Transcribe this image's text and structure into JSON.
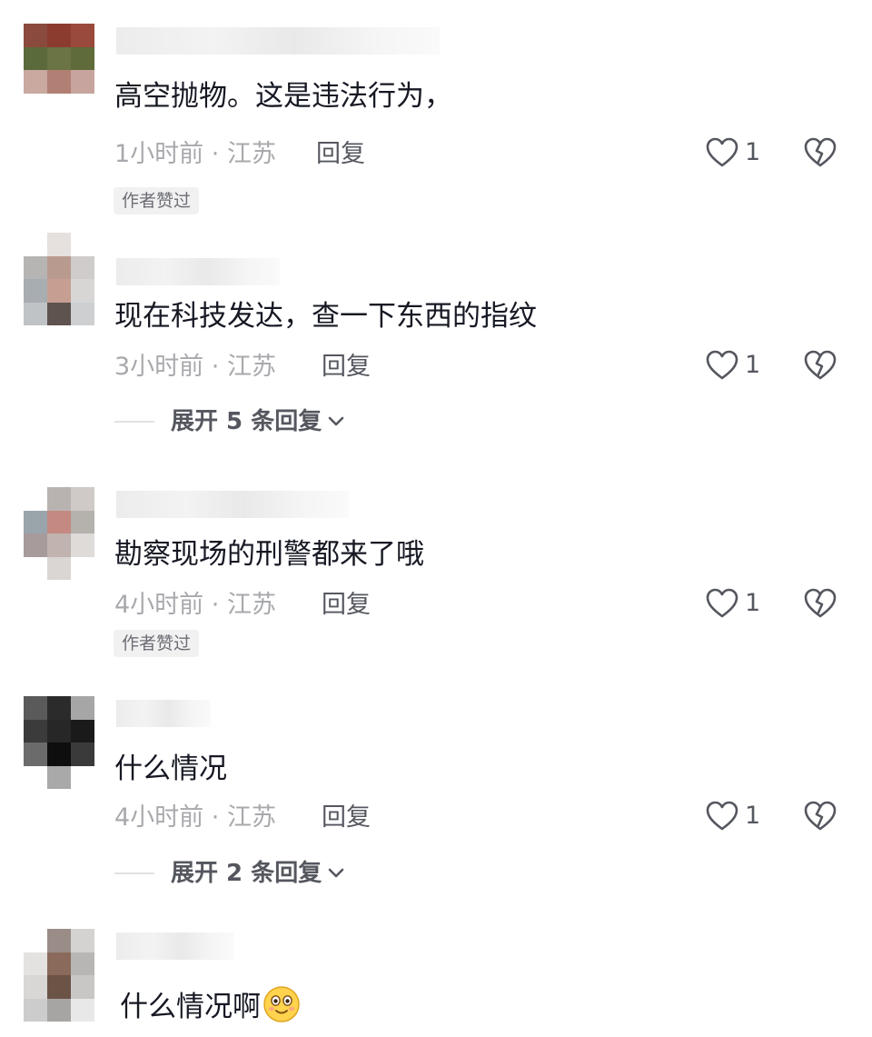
{
  "colors": {
    "text_primary": "#161823",
    "text_meta": "#a8a9ad",
    "text_action": "#55575f",
    "badge_bg": "#f1f1f2"
  },
  "comments": [
    {
      "text": "高空抛物。这是违法行为，",
      "time": "1小时前",
      "separator": "·",
      "location": "江苏",
      "reply_label": "回复",
      "like_icon": "heart-outline-icon",
      "like_count": "1",
      "dislike_icon": "broken-heart-icon",
      "badge": "作者赞过"
    },
    {
      "text": "现在科技发达，查一下东西的指纹",
      "time": "3小时前",
      "separator": "·",
      "location": "江苏",
      "reply_label": "回复",
      "like_icon": "heart-outline-icon",
      "like_count": "1",
      "dislike_icon": "broken-heart-icon",
      "expand_label": "展开 5 条回复",
      "expand_icon": "chevron-down-icon"
    },
    {
      "text": "勘察现场的刑警都来了哦",
      "time": "4小时前",
      "separator": "·",
      "location": "江苏",
      "reply_label": "回复",
      "like_icon": "heart-outline-icon",
      "like_count": "1",
      "dislike_icon": "broken-heart-icon",
      "badge": "作者赞过"
    },
    {
      "text": "什么情况",
      "time": "4小时前",
      "separator": "·",
      "location": "江苏",
      "reply_label": "回复",
      "like_icon": "heart-outline-icon",
      "like_count": "1",
      "dislike_icon": "broken-heart-icon",
      "expand_label": "展开 2 条回复",
      "expand_icon": "chevron-down-icon"
    },
    {
      "text": "什么情况啊",
      "emoji_icon": "smiling-face-emoji-icon"
    }
  ]
}
